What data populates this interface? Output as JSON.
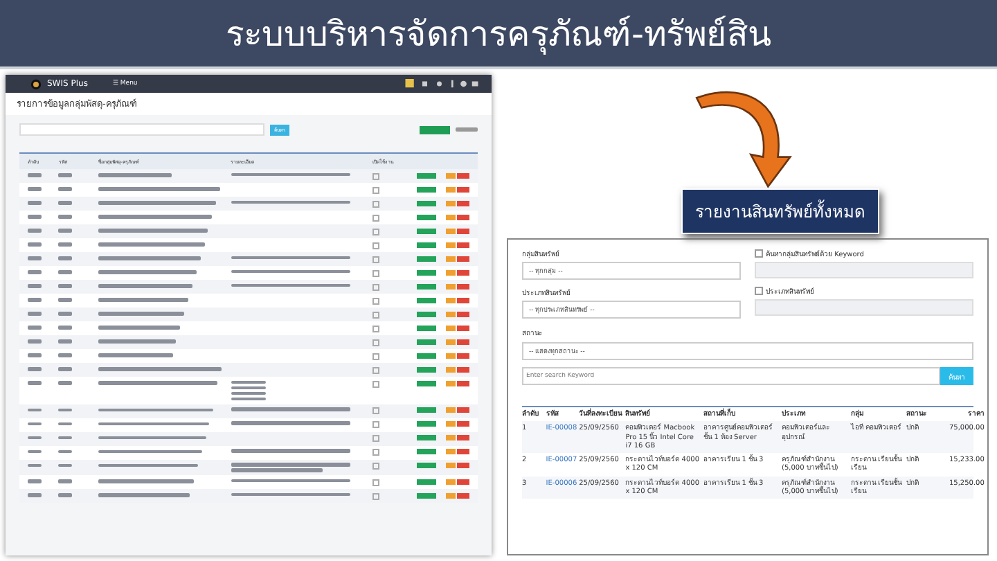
{
  "slide_title": "ระบบบริหารจัดการครุภัณฑ์-ทรัพย์สิน",
  "callout": "รายงานสินทรัพย์ทั้งหมด",
  "left_app": {
    "brand": "SWIS Plus",
    "menu": "☰ Menu",
    "page_title": "รายการข้อมูลกลุ่มพัสดุ-ครุภัณฑ์",
    "search_button": "ค้นหา",
    "columns": [
      "ลำดับ",
      "รหัส",
      "ชื่อกลุ่มพัสดุ-ครุภัณฑ์",
      "รายละเอียด",
      "เปิดใช้งาน"
    ],
    "rows": [
      {
        "kind": "line",
        "checked": false
      },
      {
        "kind": "none",
        "checked": false
      },
      {
        "kind": "line",
        "checked": false
      },
      {
        "kind": "none",
        "checked": false
      },
      {
        "kind": "none",
        "checked": false
      },
      {
        "kind": "none",
        "checked": false
      },
      {
        "kind": "line",
        "checked": false
      },
      {
        "kind": "line",
        "checked": false
      },
      {
        "kind": "line",
        "checked": false
      },
      {
        "kind": "none",
        "checked": false
      },
      {
        "kind": "none",
        "checked": false
      },
      {
        "kind": "none",
        "checked": false
      },
      {
        "kind": "none",
        "checked": false
      },
      {
        "kind": "none",
        "checked": false
      },
      {
        "kind": "none",
        "checked": false
      },
      {
        "kind": "list",
        "checked": false
      },
      {
        "kind": "line",
        "checked": false
      },
      {
        "kind": "line",
        "checked": false
      },
      {
        "kind": "none",
        "checked": false
      },
      {
        "kind": "line",
        "checked": false
      },
      {
        "kind": "double",
        "checked": false
      },
      {
        "kind": "line",
        "checked": false
      },
      {
        "kind": "line",
        "checked": false
      }
    ]
  },
  "report": {
    "group_label": "กลุ่มสินทรัพย์",
    "group_value": "-- ทุกกลุ่ม --",
    "group_kw_label": "ค้นหากลุ่มสินทรัพย์ด้วย Keyword",
    "group_kw_checked": false,
    "type_label": "ประเภทสินทรัพย์",
    "type_value": "-- ทุกประเภทสินทรัพย์ --",
    "type_kw_label": "ประเภทสินทรัพย์",
    "type_kw_checked": false,
    "status_label": "สถานะ",
    "status_value": "-- แสดงทุกสถานะ --",
    "search_placeholder": "Enter search Keyword",
    "search_button": "ค้นหา",
    "columns": [
      "ลำดับ",
      "รหัส",
      "วันที่ลงทะเบียน",
      "สินทรัพย์",
      "สถานที่เก็บ",
      "ประเภท",
      "กลุ่ม",
      "สถานะ",
      "ราคา"
    ],
    "rows": [
      [
        "1",
        "IE-00008",
        "25/09/2560",
        "คอมพิวเตอร์ Macbook Pro 15 นิ้ว Intel Core i7 16 GB",
        "อาคารศูนย์คอมพิวเตอร์ ชั้น 1 ห้อง Server",
        "คอมพิวเตอร์และอุปกรณ์",
        "ไอที คอมพิวเตอร์",
        "ปกติ",
        "75,000.00"
      ],
      [
        "2",
        "IE-00007",
        "25/09/2560",
        "กระดานไวท์บอร์ด 4000 x 120 CM",
        "อาคารเรียน 1 ชั้น 3",
        "ครุภัณฑ์สำนักงาน (5,000 บาทขึ้นไป)",
        "กระดาน เรียนชั้น เรียน",
        "ปกติ",
        "15,233.00"
      ],
      [
        "3",
        "IE-00006",
        "25/09/2560",
        "กระดานไวท์บอร์ด 4000 x 120 CM",
        "อาคารเรียน 1 ชั้น 3",
        "ครุภัณฑ์สำนักงาน (5,000 บาทขึ้นไป)",
        "กระดาน เรียนชั้น เรียน",
        "ปกติ",
        "15,250.00"
      ]
    ]
  }
}
